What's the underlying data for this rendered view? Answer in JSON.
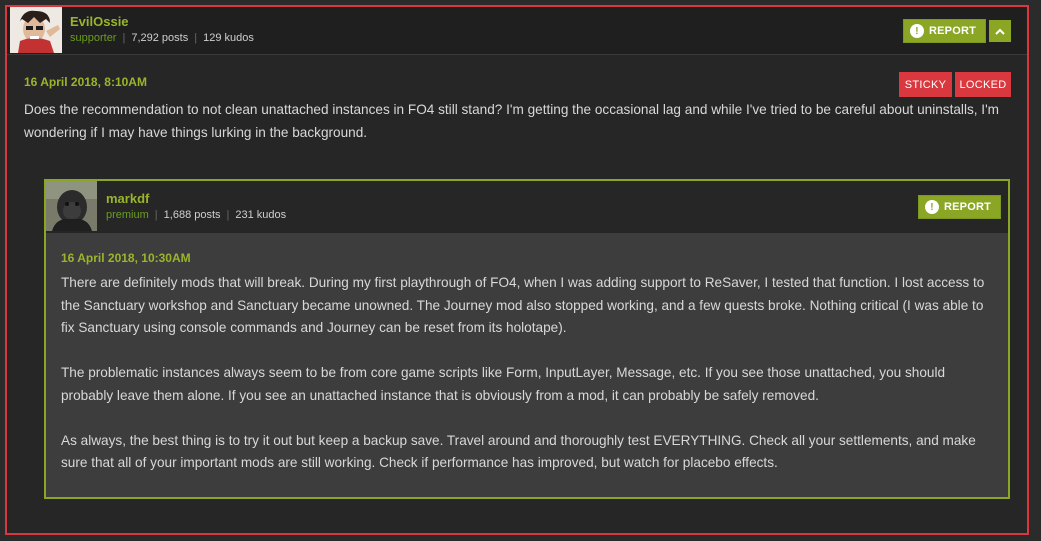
{
  "post": {
    "author": "EvilOssie",
    "rank": "supporter",
    "posts": "7,292 posts",
    "kudos": "129 kudos",
    "report_label": "REPORT",
    "date": "16 April 2018, 8:10AM",
    "badges": [
      "STICKY",
      "LOCKED"
    ],
    "body": "Does the recommendation to not clean unattached instances in FO4 still stand? I'm getting the occasional lag and while I've tried to be careful about uninstalls, I'm wondering if I may have things lurking in the background."
  },
  "reply": {
    "author": "markdf",
    "rank": "premium",
    "posts": "1,688 posts",
    "kudos": "231 kudos",
    "report_label": "REPORT",
    "date": "16 April 2018, 10:30AM",
    "paragraphs": [
      "There are definitely mods that will break. During my first playthrough of FO4, when I was adding support to ReSaver, I tested that function. I lost access to the Sanctuary workshop and Sanctuary became unowned. The Journey mod also stopped working, and a few quests broke. Nothing critical (I was able to fix Sanctuary using console commands and Journey can be reset from its holotape).",
      "The problematic instances always seem to be from core game scripts like Form, InputLayer, Message, etc. If you see those unattached, you should probably leave them alone. If you see an unattached instance that is obviously from a mod, it can probably be safely removed.",
      "As always, the best thing is to try it out but keep a backup save. Travel around and thoroughly test EVERYTHING. Check all your settlements, and make sure that all of your important mods are still working. Check if performance has improved, but watch for placebo effects."
    ]
  },
  "colors": {
    "accent_green": "#8aa624",
    "alert_red": "#d9393e"
  },
  "icons": {
    "report": "alert-circle-icon",
    "collapse": "chevron-up-icon"
  }
}
